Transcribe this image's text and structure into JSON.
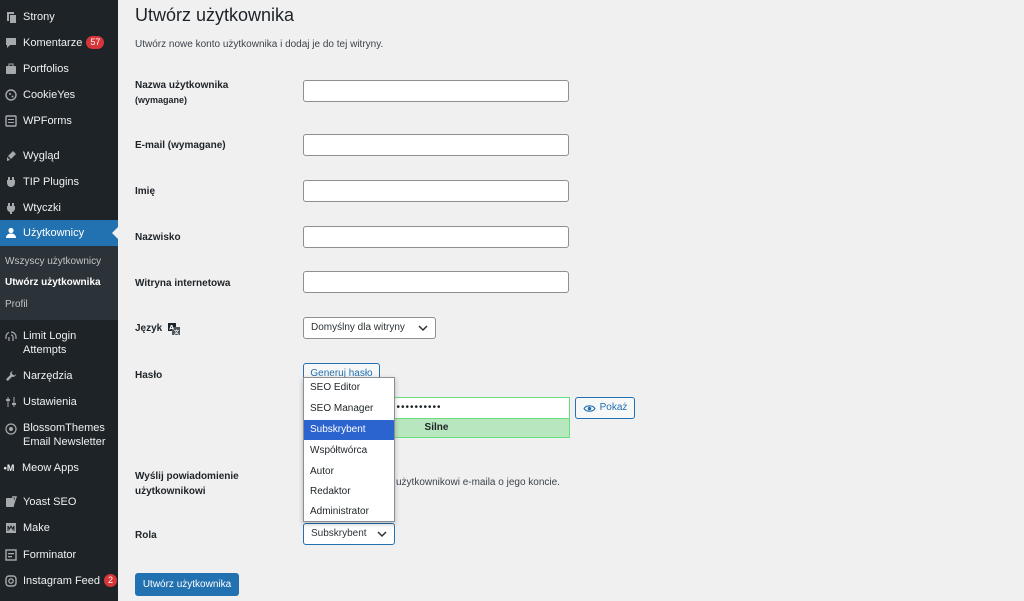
{
  "colors": {
    "sidebar_bg": "#1d2327",
    "accent": "#2271b1",
    "badge": "#d63638",
    "strength_bg": "#b8e6bf"
  },
  "sidebar": {
    "items": [
      {
        "label": "Strony",
        "icon": "pages-icon"
      },
      {
        "label": "Komentarze",
        "icon": "comments-icon",
        "badge": "57"
      },
      {
        "label": "Portfolios",
        "icon": "portfolio-icon"
      },
      {
        "label": "CookieYes",
        "icon": "cookie-icon"
      },
      {
        "label": "WPForms",
        "icon": "forms-icon"
      },
      {
        "label": "Wygląd",
        "icon": "appearance-icon"
      },
      {
        "label": "TIP Plugins",
        "icon": "plugin-icon"
      },
      {
        "label": "Wtyczki",
        "icon": "plugins-icon"
      },
      {
        "label": "Użytkownicy",
        "icon": "users-icon"
      },
      {
        "label": "Limit Login Attempts",
        "icon": "fingerprint-icon"
      },
      {
        "label": "Narzędzia",
        "icon": "tools-icon"
      },
      {
        "label": "Ustawienia",
        "icon": "settings-icon"
      },
      {
        "label": "BlossomThemes Email Newsletter",
        "icon": "newsletter-icon"
      },
      {
        "label": "Meow Apps",
        "icon": "meow-icon"
      },
      {
        "label": "Yoast SEO",
        "icon": "yoast-icon"
      },
      {
        "label": "Make",
        "icon": "make-icon"
      },
      {
        "label": "Forminator",
        "icon": "forminator-icon"
      },
      {
        "label": "Instagram Feed",
        "icon": "instagram-icon",
        "badge": "2"
      }
    ],
    "submenu": [
      "Wszyscy użytkownicy",
      "Utwórz użytkownika",
      "Profil"
    ]
  },
  "page": {
    "title": "Utwórz użytkownika",
    "description": "Utwórz nowe konto użytkownika i dodaj je do tej witryny."
  },
  "form": {
    "username_label_1": "Nazwa użytkownika",
    "username_label_2": "(wymagane)",
    "email_label": "E-mail (wymagane)",
    "first_name_label": "Imię",
    "last_name_label": "Nazwisko",
    "website_label": "Witryna internetowa",
    "language_label": "Język",
    "language_value": "Domyślny dla witryny",
    "password_label": "Hasło",
    "generate_password": "Generuj hasło",
    "password_mask": "•••••••••••",
    "show_password": "Pokaż",
    "strength": "Silne",
    "notify_label_1": "Wyślij powiadomienie",
    "notify_label_2": "użytkownikowi",
    "notify_text": "użytkownikowi e-maila o jego koncie.",
    "role_label": "Rola",
    "role_value": "Subskrybent",
    "role_options": [
      "SEO Editor",
      "SEO Manager",
      "Subskrybent",
      "Współtwórca",
      "Autor",
      "Redaktor",
      "Administrator"
    ],
    "submit": "Utwórz użytkownika"
  }
}
